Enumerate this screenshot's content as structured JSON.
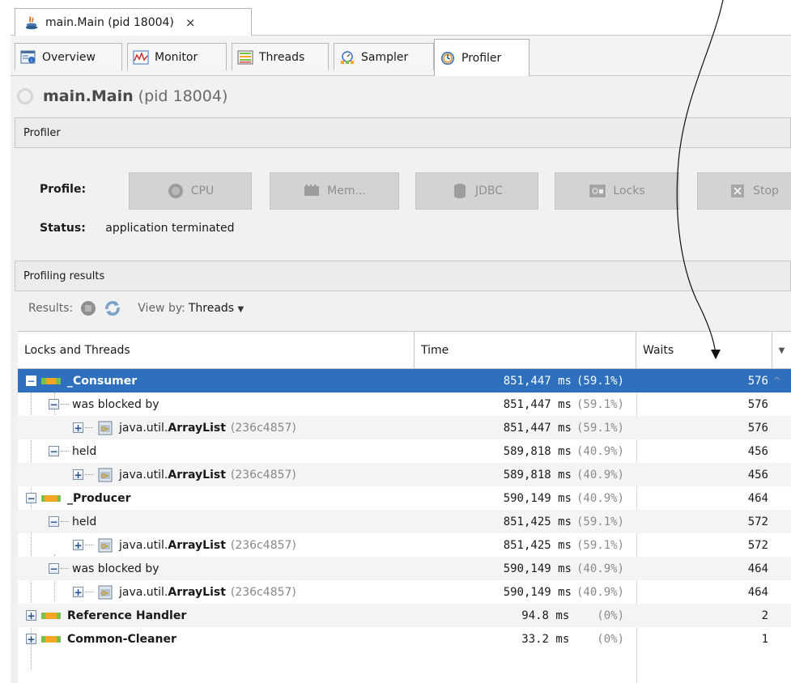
{
  "window": {
    "tab_title": "main.Main (pid 18004)",
    "close_glyph": "×"
  },
  "tabs": [
    {
      "label": "Overview",
      "icon": "overview-icon"
    },
    {
      "label": "Monitor",
      "icon": "monitor-icon"
    },
    {
      "label": "Threads",
      "icon": "threads-icon"
    },
    {
      "label": "Sampler",
      "icon": "sampler-icon"
    },
    {
      "label": "Profiler",
      "icon": "profiler-icon",
      "active": true
    }
  ],
  "header": {
    "app_name": "main.Main",
    "pid": "(pid 18004)"
  },
  "profiler_section": {
    "title": "Profiler",
    "profile_label": "Profile:",
    "buttons": [
      "CPU",
      "Mem...",
      "JDBC",
      "Locks",
      "Stop"
    ],
    "status_label": "Status:",
    "status_value": "application terminated"
  },
  "results_section": {
    "title": "Profiling results",
    "results_label": "Results:",
    "view_by_label": "View by:",
    "view_by_value": "Threads"
  },
  "table": {
    "columns": [
      "Locks and Threads",
      "Time",
      "Waits"
    ],
    "rows": [
      {
        "name": "_Consumer",
        "time": "851,447 ms",
        "pct": "(59.1%)",
        "waits": "576"
      },
      {
        "name": "was blocked by",
        "time": "851,447 ms",
        "pct": "(59.1%)",
        "waits": "576"
      },
      {
        "name_pre": "java.util.",
        "name_bold": "ArrayList",
        "id": "(236c4857)",
        "time": "851,447 ms",
        "pct": "(59.1%)",
        "waits": "576"
      },
      {
        "name": "held",
        "time": "589,818 ms",
        "pct": "(40.9%)",
        "waits": "456"
      },
      {
        "name_pre": "java.util.",
        "name_bold": "ArrayList",
        "id": "(236c4857)",
        "time": "589,818 ms",
        "pct": "(40.9%)",
        "waits": "456"
      },
      {
        "name": "_Producer",
        "time": "590,149 ms",
        "pct": "(40.9%)",
        "waits": "464"
      },
      {
        "name": "held",
        "time": "851,425 ms",
        "pct": "(59.1%)",
        "waits": "572"
      },
      {
        "name_pre": "java.util.",
        "name_bold": "ArrayList",
        "id": "(236c4857)",
        "time": "851,425 ms",
        "pct": "(59.1%)",
        "waits": "572"
      },
      {
        "name": "was blocked by",
        "time": "590,149 ms",
        "pct": "(40.9%)",
        "waits": "464"
      },
      {
        "name_pre": "java.util.",
        "name_bold": "ArrayList",
        "id": "(236c4857)",
        "time": "590,149 ms",
        "pct": "(40.9%)",
        "waits": "464"
      },
      {
        "name": "Reference Handler",
        "time": "94.8 ms",
        "pct": "(0%)",
        "waits": "2"
      },
      {
        "name": "Common-Cleaner",
        "time": "33.2 ms",
        "pct": "(0%)",
        "waits": "1"
      }
    ]
  },
  "colors": {
    "selection": "#2e70bd",
    "thread_icon_orange": "#f5a623",
    "thread_icon_green": "#7cc04b"
  }
}
